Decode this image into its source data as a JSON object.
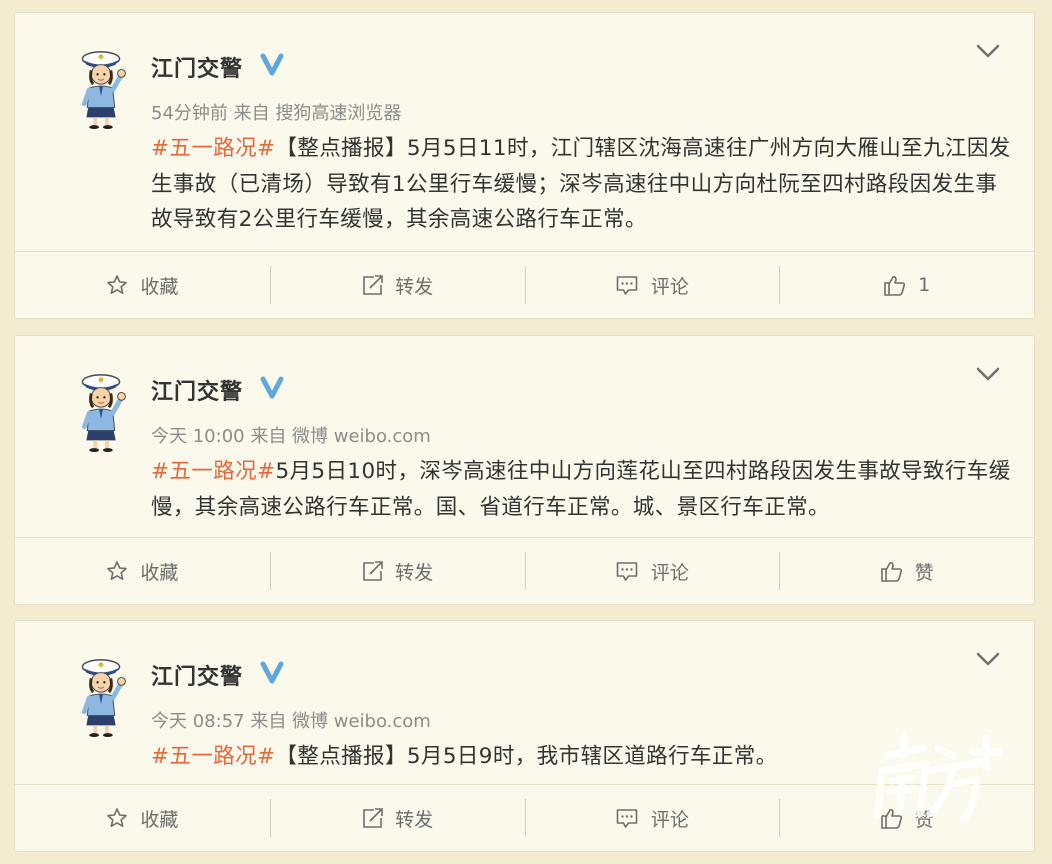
{
  "posts": [
    {
      "author": "江门交警",
      "meta": "54分钟前 来自 搜狗高速浏览器",
      "tag": "#五一路况#",
      "text": "【整点播报】5月5日11时，江门辖区沈海高速往广州方向大雁山至九江因发生事故（已清场）导致有1公里行车缓慢；深岑高速往中山方向杜阮至四村路段因发生事故导致有2公里行车缓慢，其余高速公路行车正常。",
      "actions": {
        "favorite": "收藏",
        "repost": "转发",
        "comment": "评论",
        "like": "1"
      }
    },
    {
      "author": "江门交警",
      "meta": "今天 10:00 来自 微博 weibo.com",
      "tag": "#五一路况#",
      "text": "5月5日10时，深岑高速往中山方向莲花山至四村路段因发生事故导致行车缓慢，其余高速公路行车正常。国、省道行车正常。城、景区行车正常。",
      "actions": {
        "favorite": "收藏",
        "repost": "转发",
        "comment": "评论",
        "like": "赞"
      }
    },
    {
      "author": "江门交警",
      "meta": "今天 08:57 来自 微博 weibo.com",
      "tag": "#五一路况#",
      "text": "【整点播报】5月5日9时，我市辖区道路行车正常。",
      "actions": {
        "favorite": "收藏",
        "repost": "转发",
        "comment": "评论",
        "like": "赞"
      }
    }
  ],
  "colors": {
    "tag": "#e3693c",
    "verified": "#5fa7df",
    "background": "#f3ebd0",
    "card": "#fbf8ec"
  }
}
